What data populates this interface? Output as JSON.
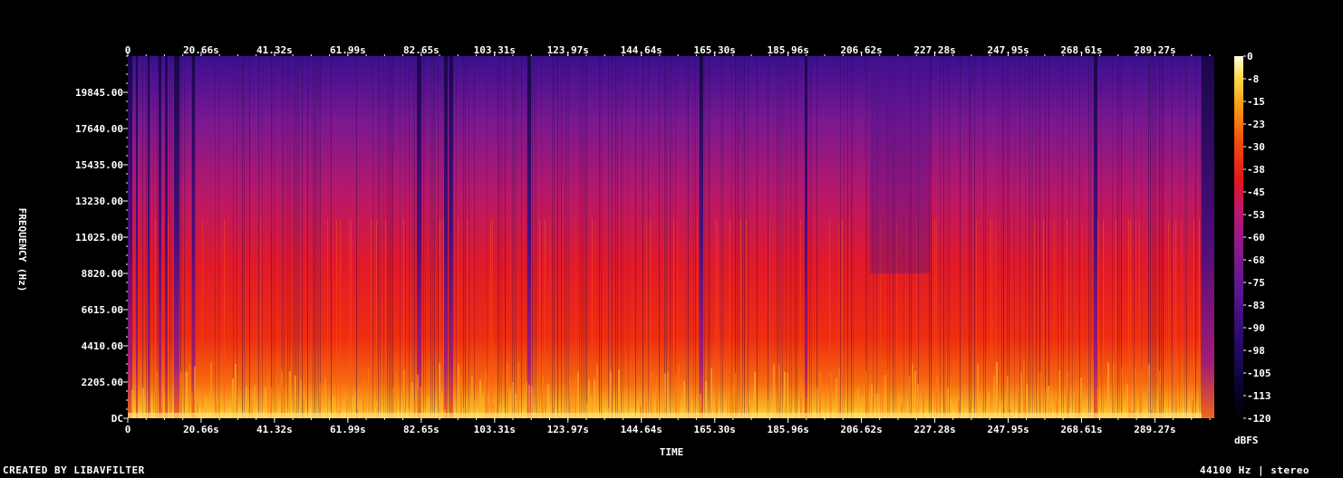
{
  "chart_data": {
    "type": "heatmap",
    "title": "",
    "xlabel": "TIME",
    "ylabel": "FREQUENCY (Hz)",
    "x_ticks": [
      "0",
      "20.66s",
      "41.32s",
      "61.99s",
      "82.65s",
      "103.31s",
      "123.97s",
      "144.64s",
      "165.30s",
      "185.96s",
      "206.62s",
      "227.28s",
      "247.95s",
      "268.61s",
      "289.27s"
    ],
    "x_tick_values": [
      0,
      20.66,
      41.32,
      61.99,
      82.65,
      103.31,
      123.97,
      144.64,
      165.3,
      185.96,
      206.62,
      227.28,
      247.95,
      268.61,
      289.27
    ],
    "xlim": [
      0,
      306
    ],
    "y_ticks": [
      "DC",
      "2205.00",
      "4410.00",
      "6615.00",
      "8820.00",
      "11025.00",
      "13230.00",
      "15435.00",
      "17640.00",
      "19845.00"
    ],
    "y_tick_values": [
      0,
      2205,
      4410,
      6615,
      8820,
      11025,
      13230,
      15435,
      17640,
      19845
    ],
    "ylim": [
      0,
      22050
    ],
    "colorbar": {
      "unit": "dBFS",
      "ticks": [
        "0",
        "-8",
        "-15",
        "-23",
        "-30",
        "-38",
        "-45",
        "-53",
        "-60",
        "-68",
        "-75",
        "-83",
        "-90",
        "-98",
        "-105",
        "-113",
        "-120"
      ],
      "range": [
        -120,
        0
      ]
    },
    "grid": false,
    "legend": "colorbar-right"
  },
  "footer": {
    "left": "CREATED BY LIBAVFILTER",
    "right": "44100 Hz | stereo"
  },
  "colors": {
    "background": "#000000",
    "text": "#ffffff",
    "low": "#0b0420",
    "mid": "#8a1a8e",
    "high": "#e81c1c",
    "peak": "#fff7a0"
  }
}
